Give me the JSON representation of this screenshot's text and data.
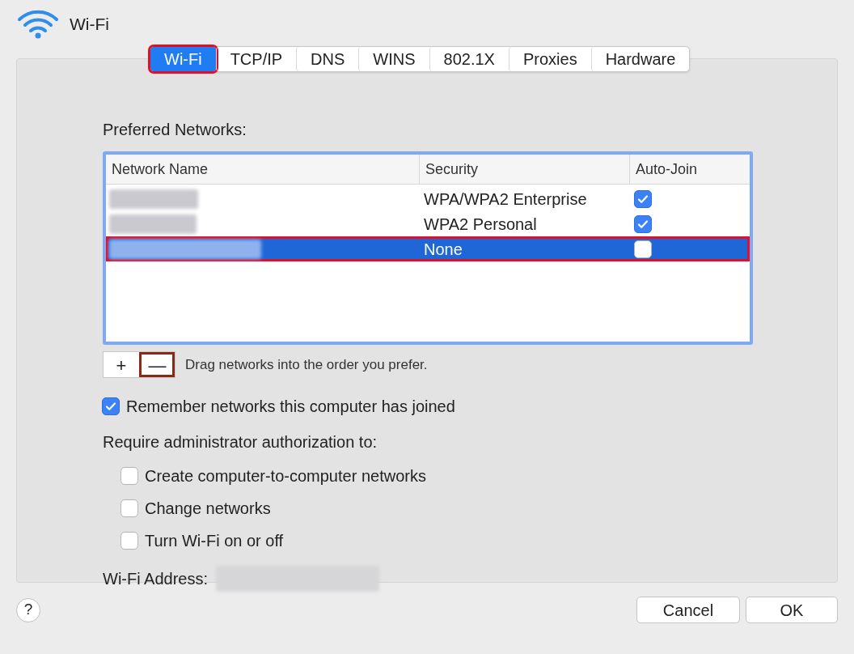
{
  "window": {
    "title": "Wi-Fi"
  },
  "tabs": [
    {
      "label": "Wi-Fi",
      "selected": true,
      "annotated": true
    },
    {
      "label": "TCP/IP",
      "selected": false,
      "annotated": false
    },
    {
      "label": "DNS",
      "selected": false,
      "annotated": false
    },
    {
      "label": "WINS",
      "selected": false,
      "annotated": false
    },
    {
      "label": "802.1X",
      "selected": false,
      "annotated": false
    },
    {
      "label": "Proxies",
      "selected": false,
      "annotated": false
    },
    {
      "label": "Hardware",
      "selected": false,
      "annotated": false
    }
  ],
  "preferred_networks": {
    "label": "Preferred Networks:",
    "columns": [
      "Network Name",
      "Security",
      "Auto-Join"
    ],
    "rows": [
      {
        "security": "WPA/WPA2 Enterprise",
        "auto_join": true,
        "selected": false,
        "annotated": false
      },
      {
        "security": "WPA2 Personal",
        "auto_join": true,
        "selected": false,
        "annotated": false
      },
      {
        "security": "None",
        "auto_join": false,
        "selected": true,
        "annotated": true
      }
    ]
  },
  "list_buttons": [
    {
      "label": "+",
      "annotated": false
    },
    {
      "label": "—",
      "annotated": true
    }
  ],
  "drag_hint": "Drag networks into the order you prefer.",
  "remember": {
    "label": "Remember networks this computer has joined",
    "checked": true
  },
  "require_label": "Require administrator authorization to:",
  "require_options": [
    {
      "label": "Create computer-to-computer networks",
      "checked": false
    },
    {
      "label": "Change networks",
      "checked": false
    },
    {
      "label": "Turn Wi-Fi on or off",
      "checked": false
    }
  ],
  "address_label": "Wi-Fi Address:",
  "help": "?",
  "buttons": [
    "Cancel",
    "OK"
  ]
}
